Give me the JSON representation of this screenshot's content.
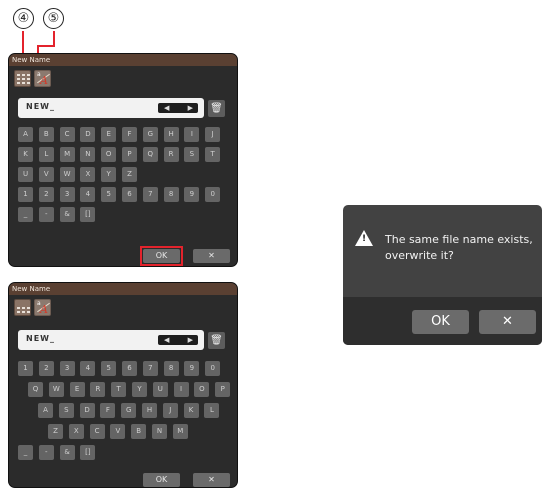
{
  "callouts": {
    "a": "④",
    "b": "⑤"
  },
  "panel_top": {
    "title": "New Name",
    "field_value": "NEW_",
    "cursor_left": "◀",
    "cursor_right": "▶",
    "trash_icon": "trash-icon",
    "keyboard_rows": [
      [
        "A",
        "B",
        "C",
        "D",
        "E",
        "F",
        "G",
        "H",
        "I",
        "J"
      ],
      [
        "K",
        "L",
        "M",
        "N",
        "O",
        "P",
        "Q",
        "R",
        "S",
        "T"
      ],
      [
        "U",
        "V",
        "W",
        "X",
        "Y",
        "Z"
      ],
      [
        "1",
        "2",
        "3",
        "4",
        "5",
        "6",
        "7",
        "8",
        "9",
        "0"
      ],
      [
        "_",
        "-",
        "&",
        "[]"
      ]
    ],
    "ok_label": "OK",
    "cancel_label": "✕"
  },
  "panel_bottom": {
    "title": "New Name",
    "field_value": "NEW_",
    "cursor_left": "◀",
    "cursor_right": "▶",
    "keyboard_rows": [
      [
        "1",
        "2",
        "3",
        "4",
        "5",
        "6",
        "7",
        "8",
        "9",
        "0"
      ],
      [
        "Q",
        "W",
        "E",
        "R",
        "T",
        "Y",
        "U",
        "I",
        "O",
        "P"
      ],
      [
        "A",
        "S",
        "D",
        "F",
        "G",
        "H",
        "J",
        "K",
        "L"
      ],
      [
        "Z",
        "X",
        "C",
        "V",
        "B",
        "N",
        "M"
      ],
      [
        "_",
        "-",
        "&",
        "[]"
      ]
    ],
    "ok_label": "OK",
    "cancel_label": "✕"
  },
  "dialog": {
    "message_line1": "The same file name exists,",
    "message_line2": "overwrite it?",
    "ok_label": "OK",
    "cancel_label": "✕"
  },
  "colors": {
    "highlight": "#e3232c",
    "panel": "#2b2b2b",
    "titlebar": "#5a4032"
  }
}
